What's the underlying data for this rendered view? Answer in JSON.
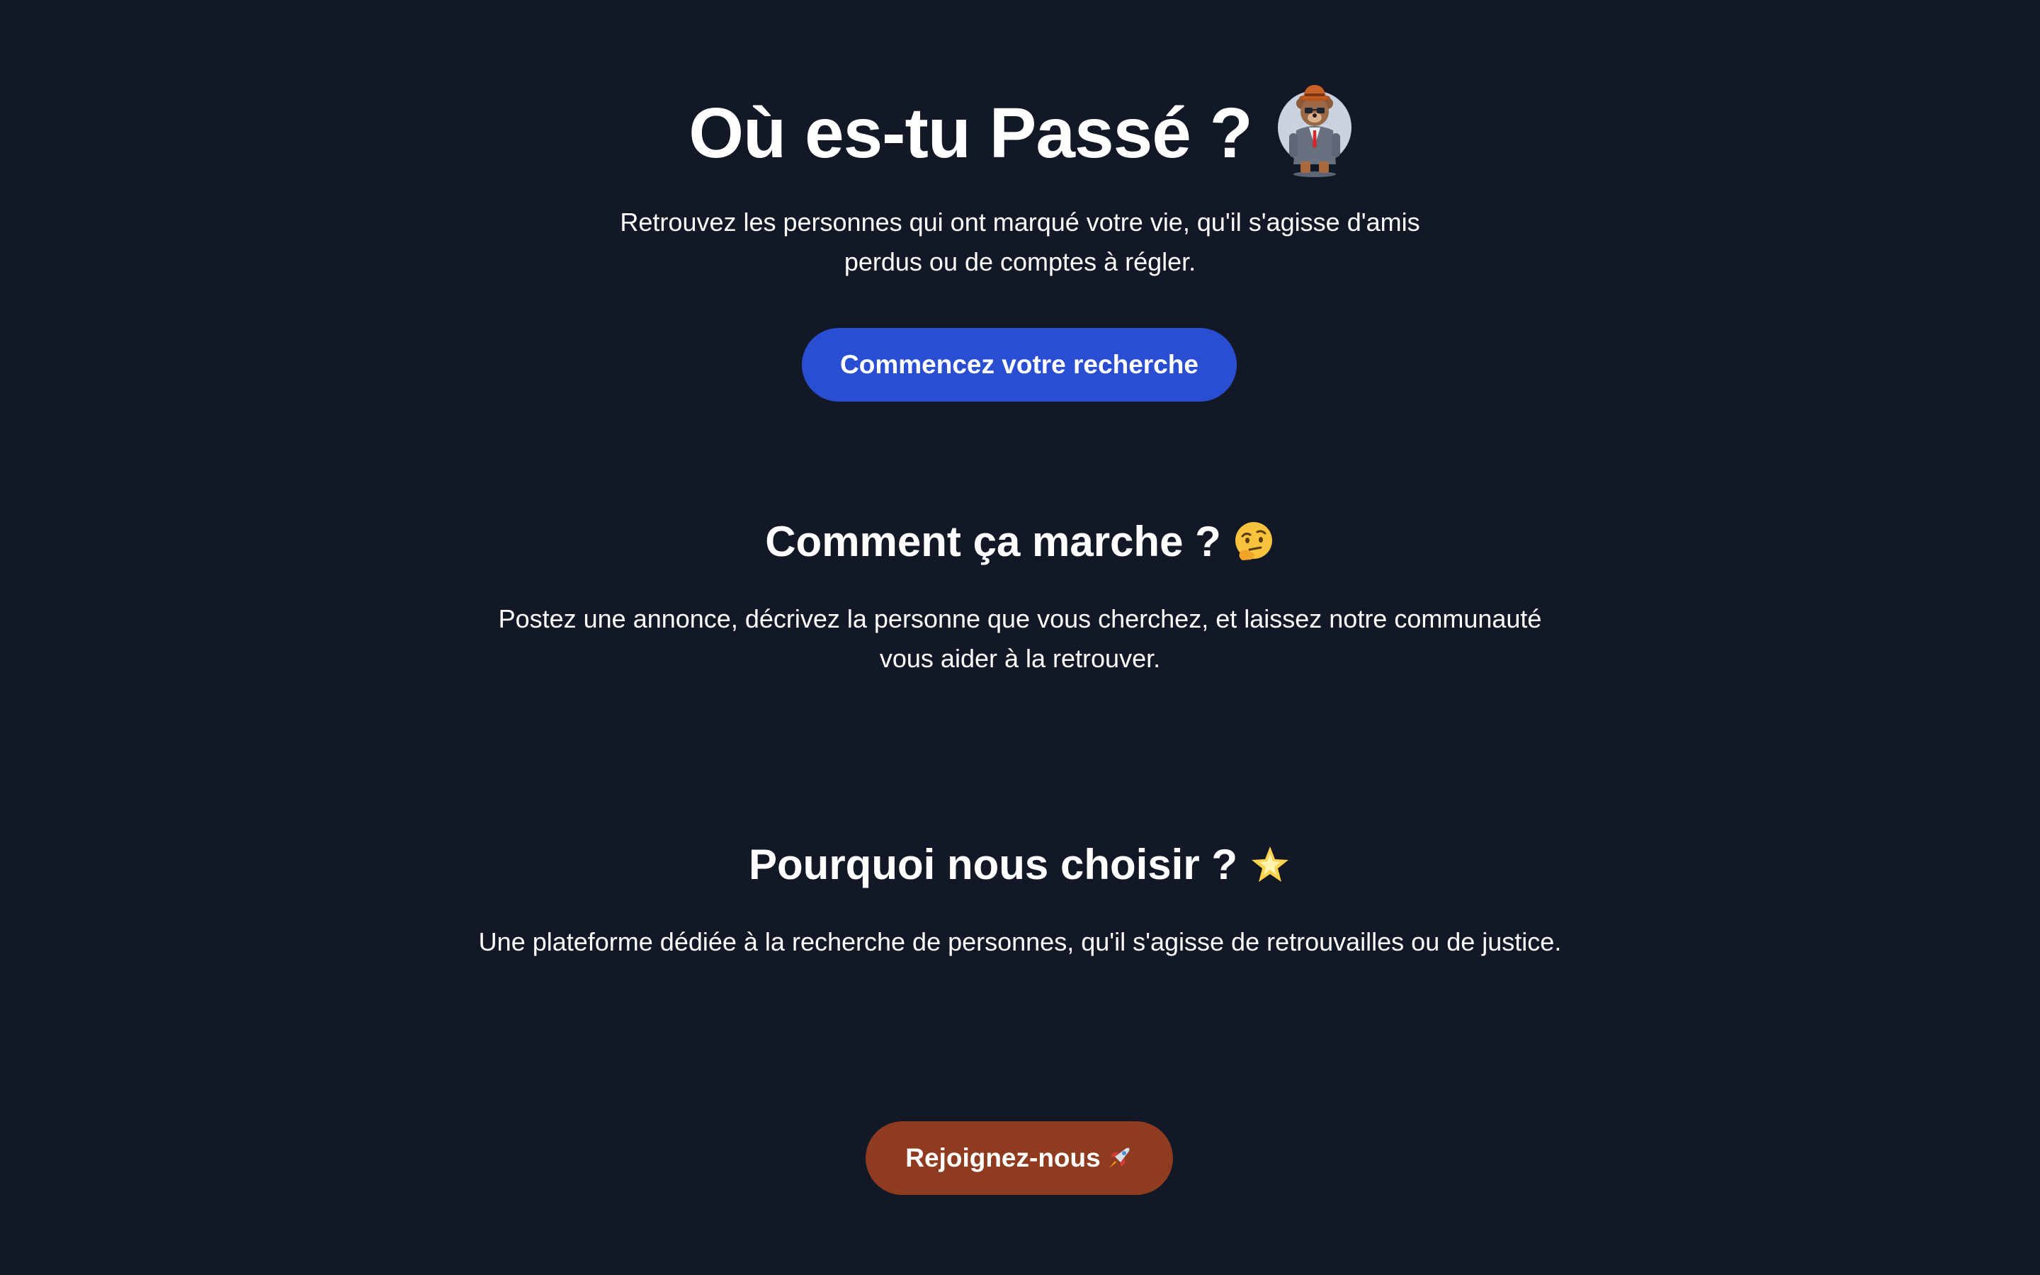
{
  "hero": {
    "title": "Où es-tu Passé ?",
    "mascot_icon": "bear-detective-icon",
    "subtitle_line1": "Retrouvez les personnes qui ont marqué votre vie, qu'il s'agisse d'amis",
    "subtitle_line2": "perdus ou de comptes à régler.",
    "cta_label": "Commencez votre recherche"
  },
  "how": {
    "title": "Comment ça marche ?",
    "icon": "thinking-face-icon",
    "text_line1": "Postez une annonce, décrivez la personne que vous cherchez, et laissez notre communauté",
    "text_line2": "vous aider à la retrouver."
  },
  "why": {
    "title": "Pourquoi nous choisir ?",
    "icon": "glowing-star-icon",
    "text": "Une plateforme dédiée à la recherche de personnes, qu'il s'agisse de retrouvailles ou de justice."
  },
  "join": {
    "label": "Rejoignez-nous",
    "icon": "rocket-icon"
  },
  "colors": {
    "background": "#121826",
    "primary_button": "#2a4ed1",
    "secondary_button": "#8e3b20",
    "text": "#ffffff"
  }
}
